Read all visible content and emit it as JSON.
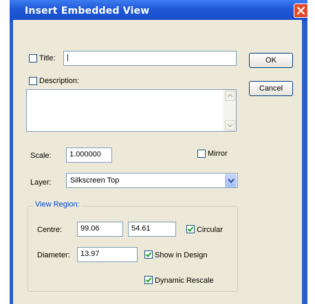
{
  "dialog": {
    "title": "Insert Embedded View",
    "ok_label": "OK",
    "cancel_label": "Cancel"
  },
  "title_field": {
    "label": "Title:",
    "checked": false,
    "value": "|"
  },
  "description": {
    "label": "Description:",
    "checked": false,
    "value": ""
  },
  "scale": {
    "label": "Scale:",
    "value": "1.000000"
  },
  "mirror": {
    "label": "Mirror",
    "checked": false
  },
  "layer": {
    "label": "Layer:",
    "value": "Silkscreen Top"
  },
  "view_region": {
    "title": "View Region:",
    "centre_label": "Centre:",
    "centre_x": "99.06",
    "centre_y": "54.61",
    "circular_label": "Circular",
    "circular_checked": true,
    "diameter_label": "Diameter:",
    "diameter": "13.97",
    "show_in_design_label": "Show in Design",
    "show_in_design_checked": true,
    "dynamic_rescale_label": "Dynamic Rescale",
    "dynamic_rescale_checked": true
  },
  "colors": {
    "titlebar": "#1f57d6",
    "window_bg": "#ece9d8",
    "group_title": "#0046d5",
    "check_mark": "#21a121"
  }
}
